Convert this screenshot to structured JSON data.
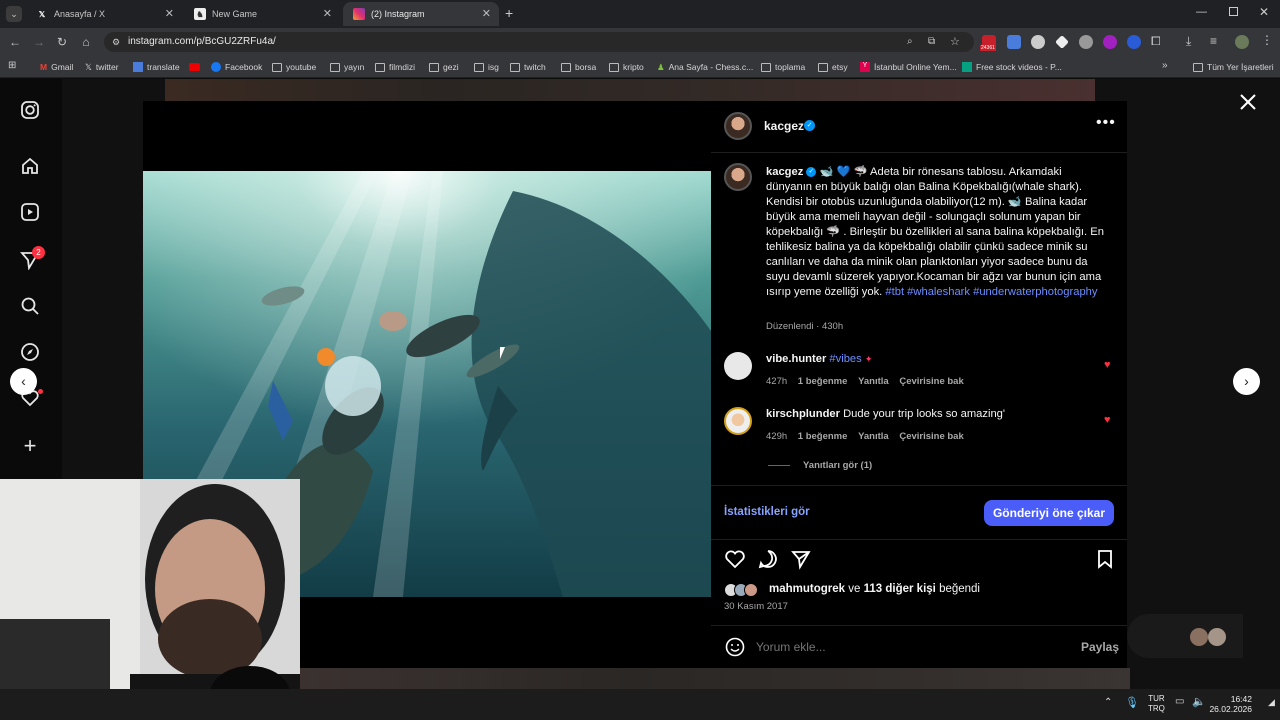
{
  "browser": {
    "tabs": [
      {
        "title": "Anasayfa / X",
        "icon": "x-logo-icon"
      },
      {
        "title": "New Game",
        "icon": "chess-icon"
      },
      {
        "title": "(2) Instagram",
        "icon": "instagram-icon"
      }
    ],
    "url": "instagram.com/p/BcGU2ZRFu4a/",
    "extension_badge": "24361",
    "bookmarks": [
      "Gmail",
      "twitter",
      "translate",
      "Facebook",
      "youtube",
      "yayın",
      "filmdizi",
      "gezi",
      "isg",
      "twitch",
      "borsa",
      "kripto",
      "Ana Sayfa - Chess.c...",
      "toplama",
      "etsy",
      "İstanbul Online Yem...",
      "Free stock videos - P..."
    ],
    "all_bookmarks": "Tüm Yer İşaretleri"
  },
  "sidebar": {
    "notification_count": "2"
  },
  "post": {
    "username": "kacgez",
    "caption_user": "kacgez",
    "caption": "🐋 💙 🦈 Adeta bir rönesans tablosu. Arkamdaki dünyanın en büyük balığı olan Balina Köpekbalığı(whale shark). Kendisi bir otobüs uzunluğunda olabiliyor(12 m). 🐋 Balina kadar büyük ama memeli hayvan değil - solungaçlı solunum yapan bir köpekbalığı 🦈 . Birleştir bu özellikleri al sana balina köpekbalığı. En tehlikesiz balina ya da köpekbalığı olabilir çünkü sadece minik su canlıları ve daha da minik olan planktonları yiyor sadece bunu da suyu devamlı süzerek yapıyor.Kocaman bir ağzı var bunun için ama ısırıp yeme özelliği yok.",
    "hashtags": [
      "#tbt",
      "#whaleshark",
      "#underwaterphotography"
    ],
    "edited": "Düzenlendi · 430h",
    "comments": [
      {
        "user": "vibe.hunter",
        "text": "#vibes",
        "time": "427h",
        "likes": "1 beğenme",
        "reply": "Yanıtla",
        "translate": "Çevirisine bak"
      },
      {
        "user": "kirschplunder",
        "text": "Dude your trip looks so amazing'",
        "time": "429h",
        "likes": "1 beğenme",
        "reply": "Yanıtla",
        "translate": "Çevirisine bak"
      }
    ],
    "view_replies": "Yanıtları gör (1)",
    "insights": "İstatistikleri gör",
    "boost": "Gönderiyi öne çıkar",
    "liked_by_user": "mahmutogrek",
    "liked_by_joiner": "ve",
    "liked_by_others": "113 diğer kişi",
    "liked_by_suffix": "beğendi",
    "date": "30 Kasım 2017",
    "comment_placeholder": "Yorum ekle...",
    "share_label": "Paylaş"
  },
  "taskbar": {
    "lang1": "TUR",
    "lang2": "TRQ",
    "time": "16:42",
    "date": "26.02.2026"
  },
  "colors": {
    "accent": "#4a5df9",
    "link": "#6b8eff",
    "like": "#ff3040"
  }
}
